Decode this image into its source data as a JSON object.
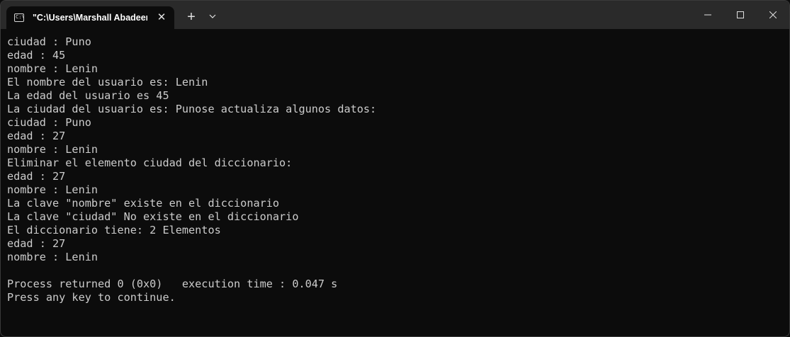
{
  "window": {
    "tab_title": "\"C:\\Users\\Marshall Abadeer\\D",
    "tab_icon": "console-icon",
    "close_tab_glyph": "✕",
    "new_tab_glyph": "+"
  },
  "console": {
    "lines": [
      "ciudad : Puno",
      "edad : 45",
      "nombre : Lenin",
      "El nombre del usuario es: Lenin",
      "La edad del usuario es 45",
      "La ciudad del usuario es: Punose actualiza algunos datos:",
      "ciudad : Puno",
      "edad : 27",
      "nombre : Lenin",
      "Eliminar el elemento ciudad del diccionario:",
      "edad : 27",
      "nombre : Lenin",
      "La clave \"nombre\" existe en el diccionario",
      "La clave \"ciudad\" No existe en el diccionario",
      "El diccionario tiene: 2 Elementos",
      "edad : 27",
      "nombre : Lenin",
      "",
      "Process returned 0 (0x0)   execution time : 0.047 s",
      "Press any key to continue."
    ]
  },
  "colors": {
    "console_bg": "#0c0c0c",
    "console_fg": "#cccccc",
    "titlebar_bg": "#2a2a2a"
  }
}
